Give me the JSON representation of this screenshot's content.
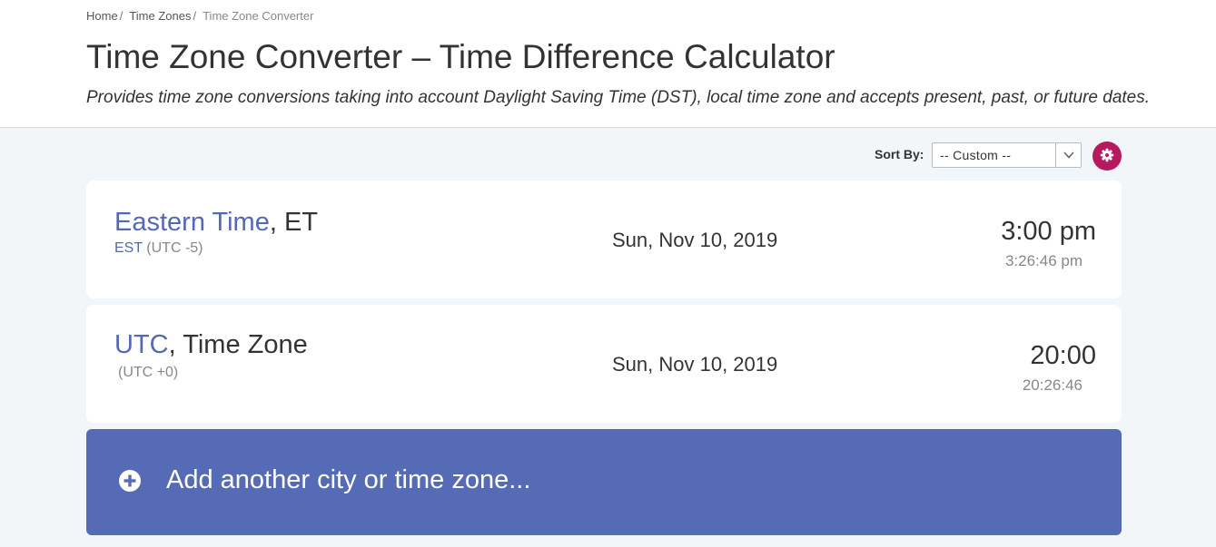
{
  "breadcrumb": {
    "items": [
      "Home",
      "Time Zones"
    ],
    "separator": "/",
    "current": "Time Zone Converter"
  },
  "page": {
    "title": "Time Zone Converter – Time Difference Calculator",
    "subtitle": "Provides time zone conversions taking into account Daylight Saving Time (DST), local time zone and accepts present, past, or future dates."
  },
  "sort": {
    "label": "Sort By:",
    "selected": "-- Custom --"
  },
  "zones": [
    {
      "name_link": "Eastern Time",
      "name_rest": ", ET",
      "abbr": "EST",
      "offset": "(UTC -5)",
      "date": "Sun, Nov 10, 2019",
      "time": "3:00 pm",
      "current_time": "3:26:46 pm"
    },
    {
      "name_link": "UTC",
      "name_rest": ", Time Zone",
      "abbr": "",
      "offset": "(UTC +0)",
      "date": "Sun, Nov 10, 2019",
      "time": "20:00",
      "current_time": "20:26:46"
    }
  ],
  "add_zone": {
    "label": "Add another city or time zone...",
    "icon": "plus-circle-icon"
  },
  "colors": {
    "link": "#5468b3",
    "settings_button": "#b5195e",
    "add_card": "#566bb5",
    "background": "#f3f6f9"
  }
}
